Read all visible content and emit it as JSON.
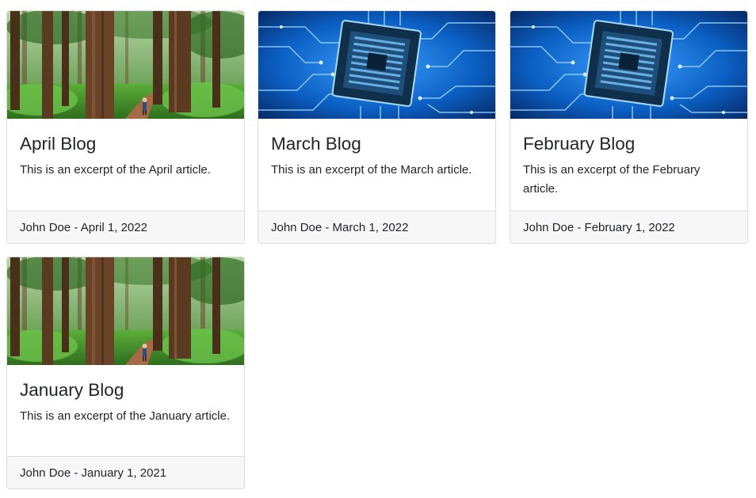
{
  "cards": [
    {
      "image": "forest-photo",
      "title": "April Blog",
      "excerpt": "This is an excerpt of the April article.",
      "footer": "John Doe - April 1, 2022"
    },
    {
      "image": "circuit-chip-photo",
      "title": "March Blog",
      "excerpt": "This is an excerpt of the March article.",
      "footer": "John Doe - March 1, 2022"
    },
    {
      "image": "circuit-chip-photo",
      "title": "February Blog",
      "excerpt": "This is an excerpt of the February article.",
      "footer": "John Doe - February 1, 2022"
    },
    {
      "image": "forest-photo",
      "title": "January Blog",
      "excerpt": "This is an excerpt of the January article.",
      "footer": "John Doe - January 1, 2021"
    }
  ],
  "colors": {
    "forest_green": "#3f8f2a",
    "trunk_brown": "#5b3a22",
    "circuit_blue": "#0a5fc4",
    "chip_dark": "#0f2f4a",
    "footer_bg": "#f7f7f7",
    "border": "#dcdcdc"
  }
}
